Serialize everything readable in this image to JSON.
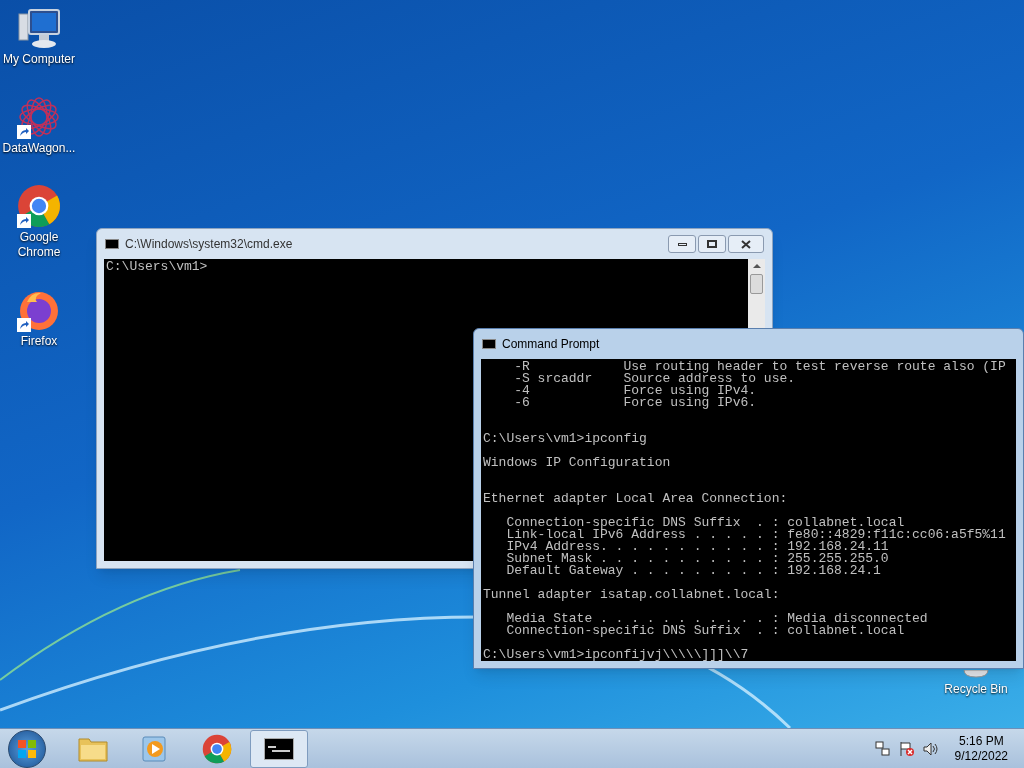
{
  "desktop_icons": [
    {
      "kind": "computer",
      "label": "My Computer",
      "shortcut": false
    },
    {
      "kind": "datawagon",
      "label": "DataWagon...",
      "shortcut": true
    },
    {
      "kind": "chrome",
      "label": "Google Chrome",
      "shortcut": true
    },
    {
      "kind": "firefox",
      "label": "Firefox",
      "shortcut": true
    }
  ],
  "recycle_bin": {
    "label": "Recycle Bin"
  },
  "windows": [
    {
      "title": "C:\\Windows\\system32\\cmd.exe",
      "active": false,
      "blocks": [
        {
          "kind": "first",
          "lines": [
            "C:\\Users\\vm1>"
          ]
        }
      ]
    },
    {
      "title": "Command Prompt",
      "active": true,
      "blocks": [
        {
          "kind": "first",
          "lines": [
            "    -R            Use routing header to test reverse route also (IP",
            "    -S srcaddr    Source address to use.",
            "    -4            Force using IPv4.",
            "    -6            Force using IPv6."
          ]
        },
        {
          "kind": "after_two_blanks",
          "lines": [
            "C:\\Users\\vm1>ipconfig"
          ]
        },
        {
          "kind": "after_blank",
          "lines": [
            "Windows IP Configuration"
          ]
        },
        {
          "kind": "after_two_blanks",
          "lines": [
            "Ethernet adapter Local Area Connection:"
          ]
        },
        {
          "kind": "after_blank",
          "lines": [
            "   Connection-specific DNS Suffix  . : collabnet.local",
            "   Link-local IPv6 Address . . . . . : fe80::4829:f11c:cc06:a5f5%11",
            "   IPv4 Address. . . . . . . . . . . : 192.168.24.11",
            "   Subnet Mask . . . . . . . . . . . : 255.255.255.0",
            "   Default Gateway . . . . . . . . . : 192.168.24.1"
          ]
        },
        {
          "kind": "after_blank",
          "lines": [
            "Tunnel adapter isatap.collabnet.local:"
          ]
        },
        {
          "kind": "after_blank",
          "lines": [
            "   Media State . . . . . . . . . . . : Media disconnected",
            "   Connection-specific DNS Suffix  . : collabnet.local"
          ]
        },
        {
          "kind": "after_blank",
          "lines": [
            "C:\\Users\\vm1>ipconfijvj\\\\\\\\\\]]]\\\\7"
          ]
        }
      ]
    }
  ],
  "taskbar": {
    "items": [
      {
        "kind": "explorer",
        "active": false
      },
      {
        "kind": "media",
        "active": false
      },
      {
        "kind": "chrome",
        "active": false
      },
      {
        "kind": "console",
        "active": true
      }
    ],
    "clock": {
      "time": "5:16 PM",
      "date": "9/12/2022"
    }
  }
}
